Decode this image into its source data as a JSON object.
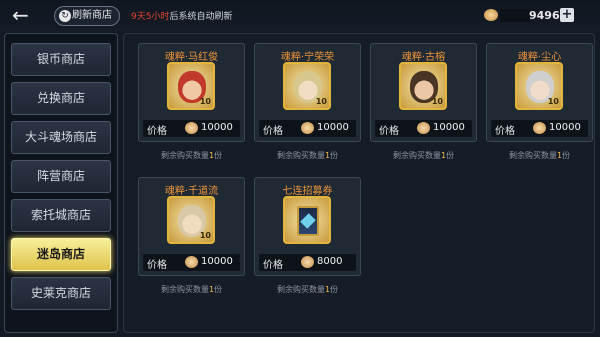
{
  "header": {
    "refresh_label": "刷新商店",
    "notice_highlight": "9天5小时",
    "notice_text": "后系统自动刷新",
    "currency_value": "9496",
    "plus_label": "+"
  },
  "sidebar": {
    "items": [
      {
        "label": "银币商店"
      },
      {
        "label": "兑换商店"
      },
      {
        "label": "大斗魂场商店"
      },
      {
        "label": "阵营商店"
      },
      {
        "label": "索托城商店"
      },
      {
        "label": "迷岛商店",
        "active": true
      },
      {
        "label": "史莱克商店"
      }
    ]
  },
  "shop": {
    "price_label": "价格",
    "remain_prefix": "剩余购买数量",
    "remain_suffix": "份",
    "items": [
      {
        "name": "魂粹·马红俊",
        "price": "10000",
        "remain": "1",
        "level": "10",
        "icon": "portrait-icon"
      },
      {
        "name": "魂粹·宁荣荣",
        "price": "10000",
        "remain": "1",
        "level": "10",
        "icon": "portrait-icon"
      },
      {
        "name": "魂粹·古榕",
        "price": "10000",
        "remain": "1",
        "level": "10",
        "icon": "portrait-icon"
      },
      {
        "name": "魂粹·尘心",
        "price": "10000",
        "remain": "1",
        "level": "10",
        "icon": "portrait-icon"
      },
      {
        "name": "魂粹·千道流",
        "price": "10000",
        "remain": "1",
        "level": "10",
        "icon": "portrait-icon"
      },
      {
        "name": "七连招募券",
        "price": "8000",
        "remain": "1",
        "icon": "recruit-ticket-icon"
      }
    ]
  },
  "colors": {
    "accent": "#f0953a",
    "highlight": "#e24433",
    "active_tab": "#f0dc6c"
  }
}
